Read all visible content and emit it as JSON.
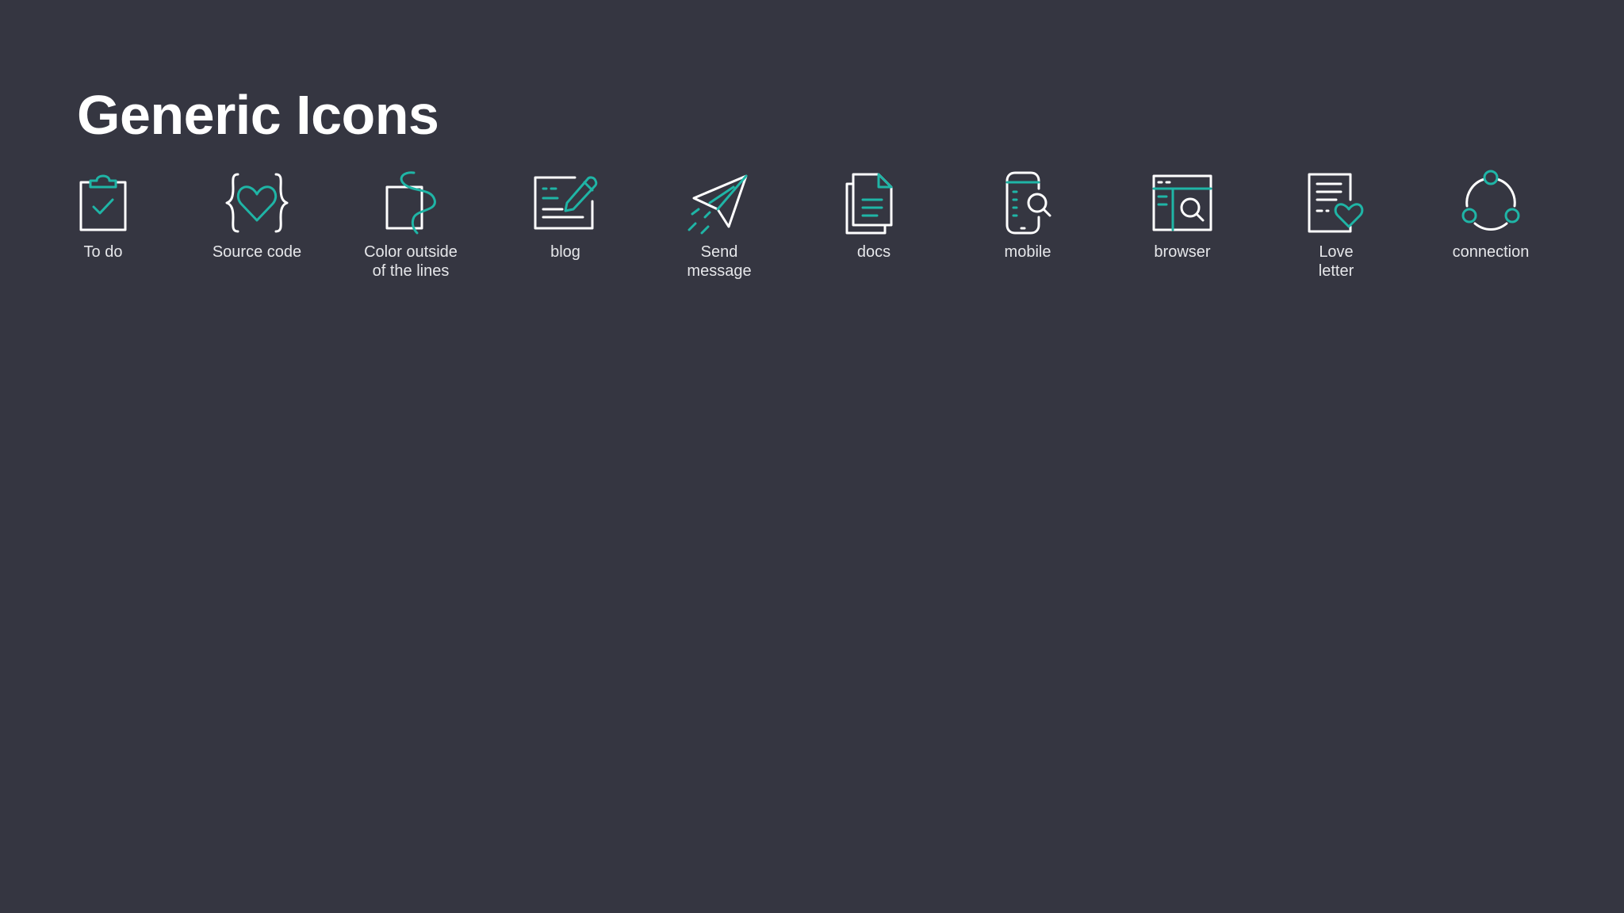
{
  "page": {
    "title": "Generic Icons"
  },
  "colors": {
    "background": "#353641",
    "icon_primary": "#ffffff",
    "icon_accent": "#1fb5a6",
    "label": "#e6e7ea"
  },
  "icons": [
    {
      "icon": "clipboard-check-icon",
      "lines": [
        "To do",
        ""
      ]
    },
    {
      "icon": "code-heart-icon",
      "lines": [
        "Source code",
        ""
      ]
    },
    {
      "icon": "scribble-square-icon",
      "lines": [
        "Color outside",
        "of the lines"
      ]
    },
    {
      "icon": "blog-pencil-icon",
      "lines": [
        "blog",
        ""
      ]
    },
    {
      "icon": "paper-plane-icon",
      "lines": [
        "Send",
        "message"
      ]
    },
    {
      "icon": "documents-icon",
      "lines": [
        "docs",
        ""
      ]
    },
    {
      "icon": "mobile-search-icon",
      "lines": [
        "mobile",
        ""
      ]
    },
    {
      "icon": "browser-search-icon",
      "lines": [
        "browser",
        ""
      ]
    },
    {
      "icon": "love-letter-icon",
      "lines": [
        "Love",
        "letter"
      ]
    },
    {
      "icon": "connection-icon",
      "lines": [
        "connection",
        ""
      ]
    }
  ]
}
